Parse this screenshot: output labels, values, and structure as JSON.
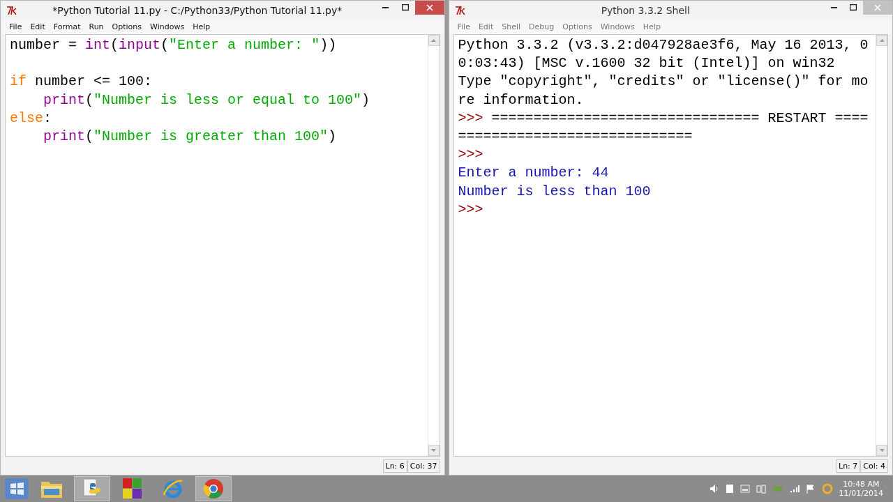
{
  "windows": [
    {
      "title": "*Python Tutorial 11.py - C:/Python33/Python Tutorial 11.py*",
      "active": true,
      "menu": [
        "File",
        "Edit",
        "Format",
        "Run",
        "Options",
        "Windows",
        "Help"
      ],
      "lines": [
        {
          "kind": "code",
          "indented": false,
          "tokens": [
            {
              "kind": "plain",
              "text": "number = "
            },
            {
              "kind": "builtin",
              "text": "int"
            },
            {
              "kind": "plain",
              "text": "("
            },
            {
              "kind": "builtin",
              "text": "input"
            },
            {
              "kind": "plain",
              "text": "("
            },
            {
              "kind": "string",
              "text": "\"Enter a number: \""
            },
            {
              "kind": "plain",
              "text": "))"
            }
          ]
        },
        {
          "kind": "blank"
        },
        {
          "kind": "code",
          "indented": false,
          "tokens": [
            {
              "kind": "keyword",
              "text": "if"
            },
            {
              "kind": "plain",
              "text": " number <= 100:"
            }
          ]
        },
        {
          "kind": "code",
          "indented": true,
          "tokens": [
            {
              "kind": "builtin",
              "text": "print"
            },
            {
              "kind": "plain",
              "text": "("
            },
            {
              "kind": "string",
              "text": "\"Number is less or equal to 100\""
            },
            {
              "kind": "plain",
              "text": ")"
            }
          ]
        },
        {
          "kind": "code",
          "indented": false,
          "tokens": [
            {
              "kind": "keyword",
              "text": "else"
            },
            {
              "kind": "plain",
              "text": ":"
            }
          ]
        },
        {
          "kind": "code",
          "indented": true,
          "tokens": [
            {
              "kind": "builtin",
              "text": "print"
            },
            {
              "kind": "plain",
              "text": "("
            },
            {
              "kind": "string",
              "text": "\"Number is greater than 100\""
            },
            {
              "kind": "plain",
              "text": ")"
            }
          ]
        }
      ],
      "status": {
        "line": "Ln: 6",
        "column": "Col: 37"
      }
    },
    {
      "title": "Python 3.3.2 Shell",
      "active": false,
      "menu": [
        "File",
        "Edit",
        "Shell",
        "Debug",
        "Options",
        "Windows",
        "Help"
      ],
      "lines": [
        {
          "kind": "code",
          "tokens": [
            {
              "kind": "plain",
              "text": "Python 3.3.2 (v3.3.2:d047928ae3f6, May 16 2013, 0"
            }
          ]
        },
        {
          "kind": "code",
          "tokens": [
            {
              "kind": "plain",
              "text": "0:03:43) [MSC v.1600 32 bit (Intel)] on win32"
            }
          ]
        },
        {
          "kind": "code",
          "tokens": [
            {
              "kind": "plain",
              "text": "Type \"copyright\", \"credits\" or \"license()\" for mo"
            }
          ]
        },
        {
          "kind": "code",
          "tokens": [
            {
              "kind": "plain",
              "text": "re information."
            }
          ]
        },
        {
          "kind": "code",
          "tokens": [
            {
              "kind": "prompt",
              "text": ">>>"
            },
            {
              "kind": "plain",
              "text": " ================================ RESTART ===="
            }
          ]
        },
        {
          "kind": "code",
          "tokens": [
            {
              "kind": "plain",
              "text": "============================"
            }
          ]
        },
        {
          "kind": "code",
          "tokens": [
            {
              "kind": "prompt",
              "text": ">>>"
            }
          ]
        },
        {
          "kind": "code",
          "tokens": [
            {
              "kind": "stdout",
              "text": "Enter a number: 44"
            }
          ]
        },
        {
          "kind": "code",
          "tokens": [
            {
              "kind": "stdout",
              "text": "Number is less than 100"
            }
          ]
        },
        {
          "kind": "code",
          "tokens": [
            {
              "kind": "prompt",
              "text": ">>>"
            }
          ]
        }
      ],
      "status": {
        "line": "Ln: 7",
        "column": "Col: 4"
      }
    }
  ],
  "taskbar": {
    "apps": [
      {
        "kind": "explorer",
        "selected": false
      },
      {
        "kind": "python",
        "selected": true
      },
      {
        "kind": "tiles",
        "selected": false
      },
      {
        "kind": "ie",
        "selected": false
      },
      {
        "kind": "chrome",
        "selected": true
      }
    ],
    "time": "10:48 AM",
    "date": "11/01/2014"
  }
}
